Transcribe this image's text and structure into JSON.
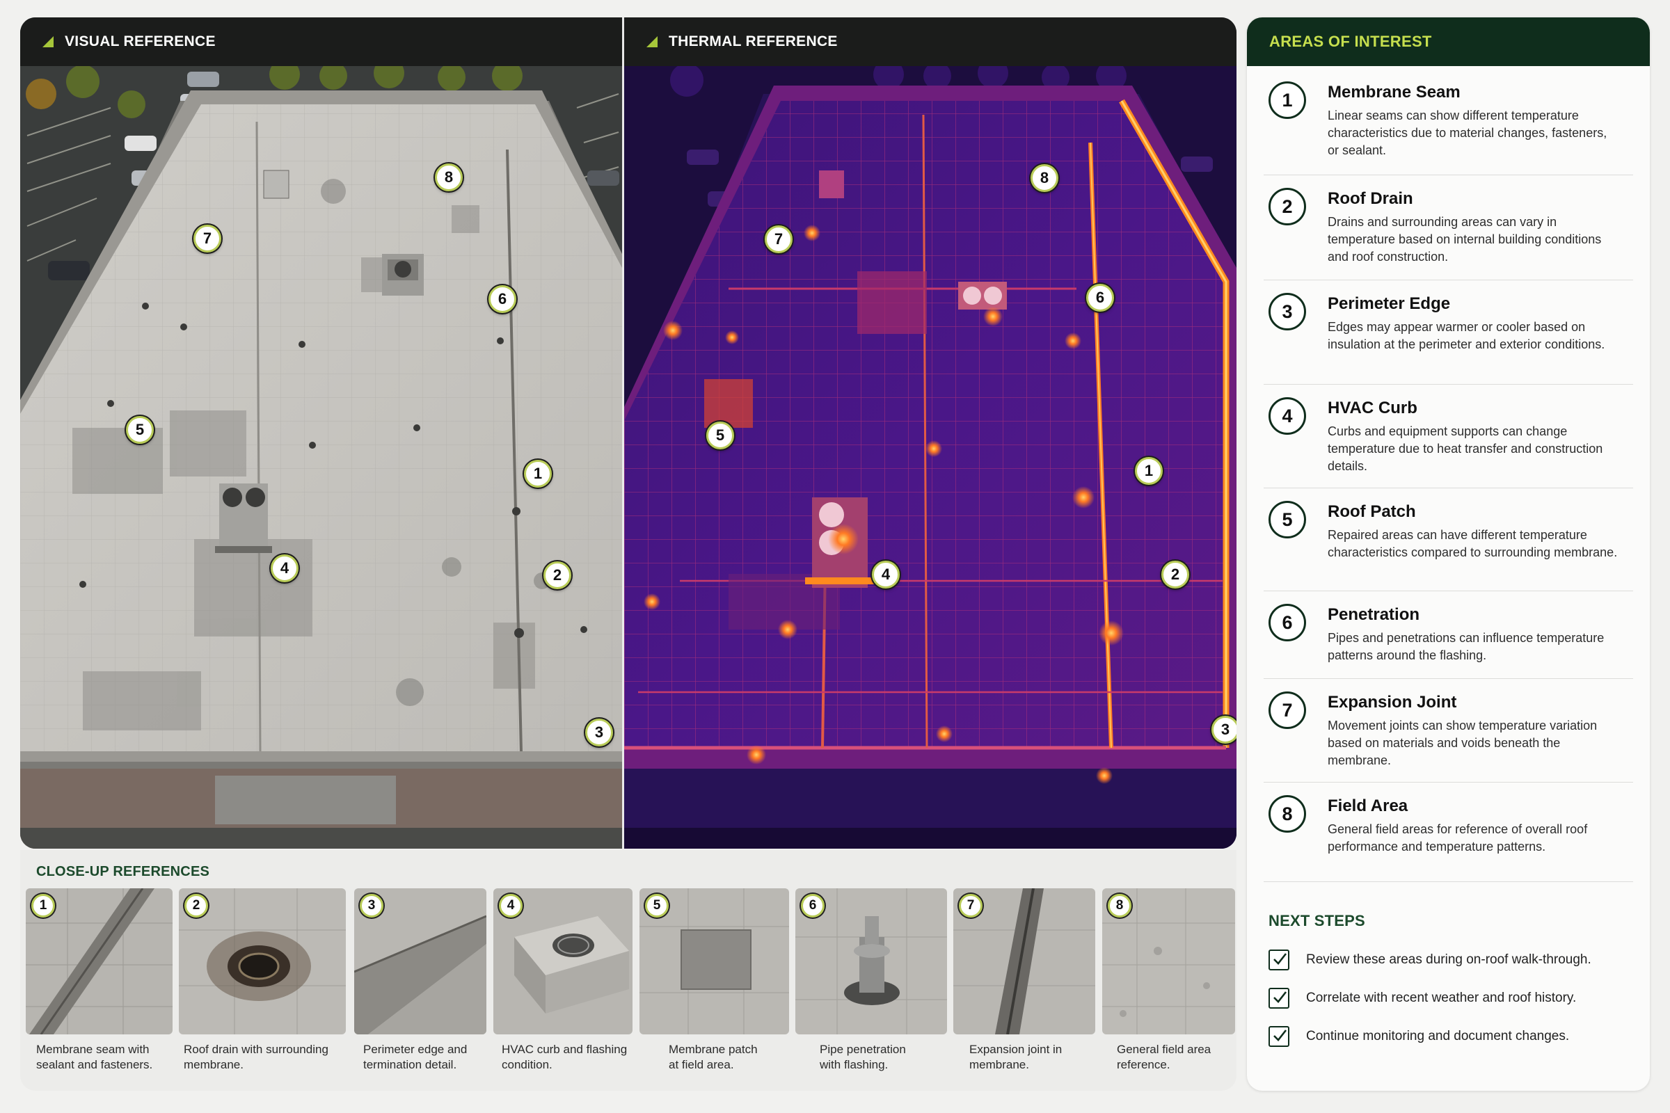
{
  "visual_panel": {
    "title": "VISUAL REFERENCE",
    "icon": "leaf-icon",
    "markers": [
      "8",
      "7",
      "6",
      "5",
      "1",
      "4",
      "2",
      "3"
    ]
  },
  "thermal_panel": {
    "title": "THERMAL REFERENCE",
    "icon": "leaf-icon",
    "markers": [
      "8",
      "7",
      "6",
      "5",
      "1",
      "4",
      "2",
      "3"
    ]
  },
  "closeups": {
    "title": "CLOSE-UP REFERENCES",
    "items": [
      {
        "num": "1",
        "caption_line1": "Membrane seam with",
        "caption_line2": "sealant and fasteners."
      },
      {
        "num": "2",
        "caption_line1": "Roof drain with surrounding",
        "caption_line2": "membrane."
      },
      {
        "num": "3",
        "caption_line1": "Perimeter edge and",
        "caption_line2": "termination detail."
      },
      {
        "num": "4",
        "caption_line1": "HVAC curb and flashing",
        "caption_line2": "condition."
      },
      {
        "num": "5",
        "caption_line1": "Membrane patch",
        "caption_line2": "at field area."
      },
      {
        "num": "6",
        "caption_line1": "Pipe penetration",
        "caption_line2": "with flashing."
      },
      {
        "num": "7",
        "caption_line1": "Expansion joint in",
        "caption_line2": "membrane."
      },
      {
        "num": "8",
        "caption_line1": "General field area",
        "caption_line2": "reference."
      }
    ]
  },
  "sidebar": {
    "title": "AREAS OF INTEREST",
    "items": [
      {
        "num": "1",
        "title": "Membrane Seam",
        "desc": "Linear seams can show different temperature characteristics due to material changes, fasteners, or sealant."
      },
      {
        "num": "2",
        "title": "Roof Drain",
        "desc": "Drains and surrounding areas can vary in temperature based on internal building conditions and roof construction."
      },
      {
        "num": "3",
        "title": "Perimeter Edge",
        "desc": "Edges may appear warmer or cooler based on insulation at the perimeter and exterior conditions."
      },
      {
        "num": "4",
        "title": "HVAC Curb",
        "desc": "Curbs and equipment supports can change temperature due to heat transfer and construction details."
      },
      {
        "num": "5",
        "title": "Roof Patch",
        "desc": "Repaired areas can have different temperature characteristics compared to surrounding membrane."
      },
      {
        "num": "6",
        "title": "Penetration",
        "desc": "Pipes and penetrations can influence temperature patterns around the flashing."
      },
      {
        "num": "7",
        "title": "Expansion Joint",
        "desc": "Movement joints can show temperature variation based on materials and voids beneath the membrane."
      },
      {
        "num": "8",
        "title": "Field Area",
        "desc": "General field areas for reference of overall roof performance and temperature patterns."
      }
    ],
    "next_steps": {
      "title": "NEXT STEPS",
      "items": [
        "Review these areas during on-roof walk-through.",
        "Correlate with recent weather and roof history.",
        "Continue monitoring and document changes."
      ]
    }
  },
  "colors": {
    "brand_dark": "#0f2d1c",
    "accent_lime": "#c6df4e",
    "marker_ring": "#b9cc58",
    "thermal_cold": "#2a0e5e",
    "thermal_hot": "#ffb23a"
  }
}
